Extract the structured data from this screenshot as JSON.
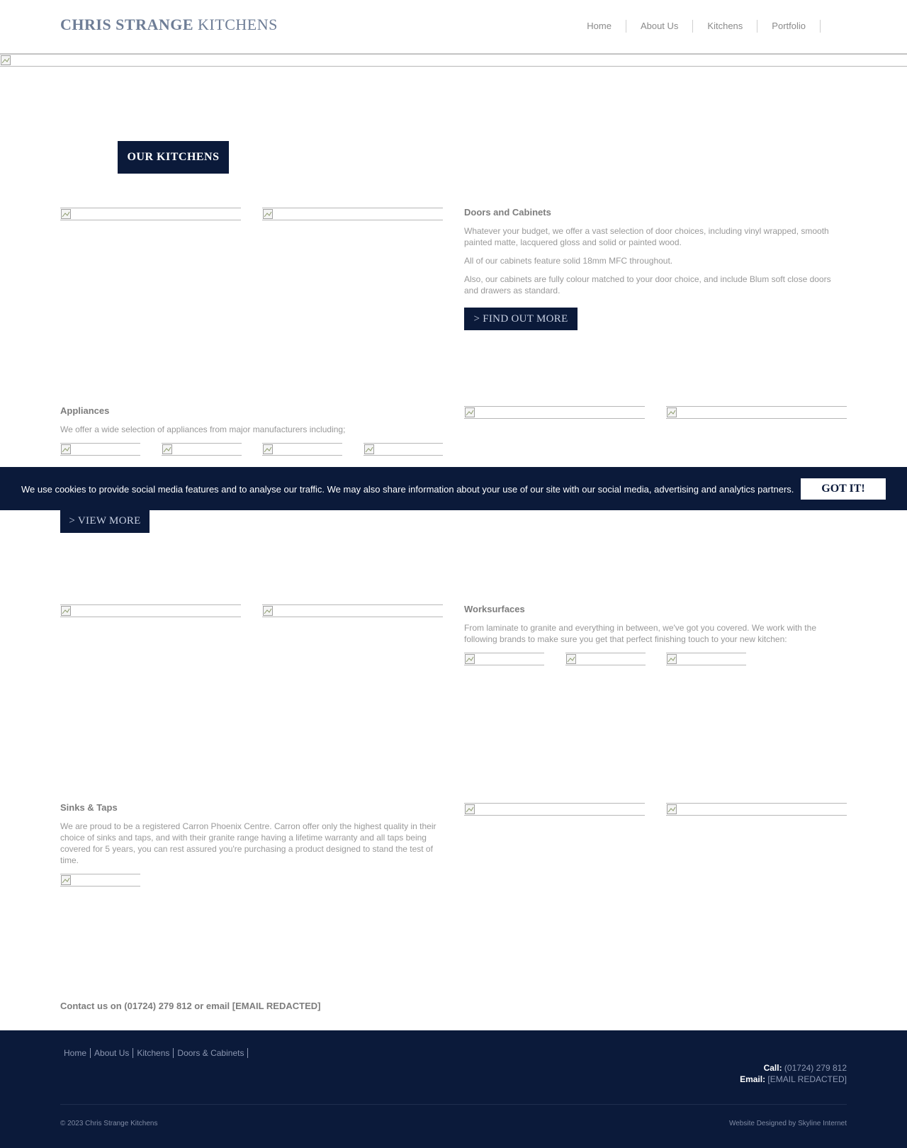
{
  "header": {
    "logo_bold": "CHRIS STRANGE",
    "logo_light": "KITCHENS",
    "nav": [
      {
        "label": "Home"
      },
      {
        "label": "About Us"
      },
      {
        "label": "Kitchens"
      },
      {
        "label": "Portfolio"
      }
    ]
  },
  "page": {
    "title": "OUR KITCHENS"
  },
  "doors": {
    "heading": "Doors and Cabinets",
    "p1": "Whatever your budget, we offer a vast selection of door choices, including vinyl wrapped, smooth painted matte, lacquered gloss and solid or painted wood.",
    "p2": "All of our cabinets feature solid 18mm MFC throughout.",
    "p3": "Also, our cabinets are fully colour matched to your door choice, and include Blum soft close doors and drawers as standard.",
    "button": "> FIND OUT MORE"
  },
  "appliances": {
    "heading": "Appliances",
    "p1": "We offer a wide selection of appliances from major manufacturers including;",
    "button": "> VIEW MORE"
  },
  "worksurfaces": {
    "heading": "Worksurfaces",
    "p1": "From laminate to granite and everything in between, we've got you covered. We work with the following brands to make sure you get that perfect finishing touch to your new kitchen:"
  },
  "sinks": {
    "heading": "Sinks & Taps",
    "p1": "We are proud to be a registered Carron Phoenix Centre. Carron offer only the highest quality in their choice of sinks and taps, and with their granite range having a lifetime warranty and all taps being covered for 5 years, you can rest assured you're purchasing a product designed to stand the test of time."
  },
  "contact": {
    "text": "Contact us on (01724) 279 812 or email [EMAIL REDACTED]"
  },
  "cookie": {
    "text": "We use cookies to provide social media features and to analyse our traffic. We may also share information about your use of our site with our social media, advertising and analytics partners.",
    "button": "GOT IT!"
  },
  "footer": {
    "nav": [
      {
        "label": "Home"
      },
      {
        "label": "About Us"
      },
      {
        "label": "Kitchens"
      },
      {
        "label": "Doors & Cabinets"
      }
    ],
    "call_label": "Call:",
    "call_value": "(01724) 279 812",
    "email_label": "Email:",
    "email_value": "[EMAIL REDACTED]",
    "copyright": "© 2023 Chris Strange Kitchens",
    "credit": "Website Designed by Skyline Internet"
  },
  "icons": {
    "broken_image": "broken-image-icon"
  },
  "colors": {
    "navy": "#0b1a3a",
    "logo": "#6e7d96",
    "text": "#999999"
  }
}
